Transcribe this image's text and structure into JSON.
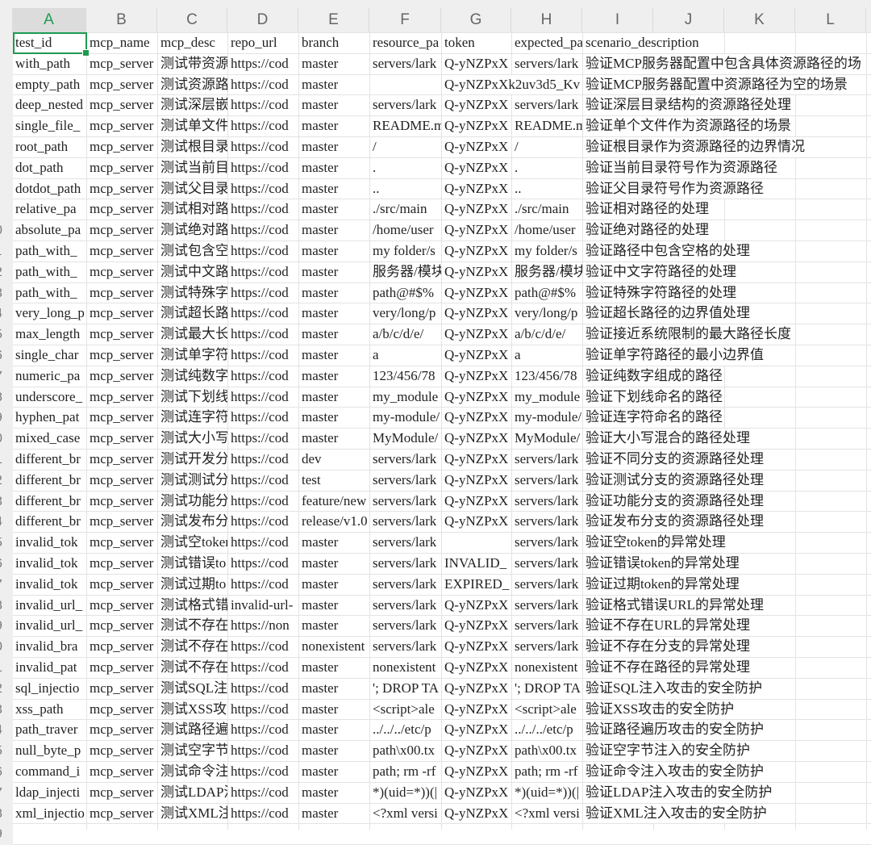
{
  "columns": [
    "A",
    "B",
    "C",
    "D",
    "E",
    "F",
    "G",
    "H",
    "I",
    "J",
    "K",
    "L"
  ],
  "selected_cell": "A1",
  "colors": {
    "accent": "#1f9a50",
    "grid": "#e3e3e3",
    "header_bg": "#efefef"
  },
  "rows": [
    [
      "test_id",
      "mcp_name",
      "mcp_desc",
      "repo_url",
      "branch",
      "resource_pa",
      "token",
      "expected_pa",
      "scenario_description"
    ],
    [
      "with_path",
      "mcp_server",
      "测试带资源",
      "https://cod",
      "master",
      "servers/lark",
      "Q-yNZPxX",
      "servers/lark",
      "验证MCP服务器配置中包含具体资源路径的场"
    ],
    [
      "empty_path",
      "mcp_server",
      "测试资源路",
      "https://cod",
      "master",
      "",
      "Q-yNZPxXk2uv3d5_Kv",
      "",
      "验证MCP服务器配置中资源路径为空的场景"
    ],
    [
      "deep_nested",
      "mcp_server",
      "测试深层嵌",
      "https://cod",
      "master",
      "servers/lark",
      "Q-yNZPxX",
      "servers/lark",
      "验证深层目录结构的资源路径处理"
    ],
    [
      "single_file_",
      "mcp_server",
      "测试单文件",
      "https://cod",
      "master",
      "README.md",
      "Q-yNZPxX",
      "README.md",
      "验证单个文件作为资源路径的场景"
    ],
    [
      "root_path",
      "mcp_server",
      "测试根目录",
      "https://cod",
      "master",
      "/",
      "Q-yNZPxX",
      "/",
      "验证根目录作为资源路径的边界情况"
    ],
    [
      "dot_path",
      "mcp_server",
      "测试当前目",
      "https://cod",
      "master",
      ".",
      "Q-yNZPxX",
      ".",
      "验证当前目录符号作为资源路径"
    ],
    [
      "dotdot_path",
      "mcp_server",
      "测试父目录",
      "https://cod",
      "master",
      "..",
      "Q-yNZPxX",
      "..",
      "验证父目录符号作为资源路径"
    ],
    [
      "relative_pa",
      "mcp_server",
      "测试相对路",
      "https://cod",
      "master",
      "./src/main",
      "Q-yNZPxX",
      "./src/main",
      "验证相对路径的处理"
    ],
    [
      "absolute_pa",
      "mcp_server",
      "测试绝对路",
      "https://cod",
      "master",
      "/home/user",
      "Q-yNZPxX",
      "/home/user",
      "验证绝对路径的处理"
    ],
    [
      "path_with_",
      "mcp_server",
      "测试包含空",
      "https://cod",
      "master",
      "my folder/s",
      "Q-yNZPxX",
      "my folder/s",
      "验证路径中包含空格的处理"
    ],
    [
      "path_with_",
      "mcp_server",
      "测试中文路",
      "https://cod",
      "master",
      "服务器/模块",
      "Q-yNZPxX",
      "服务器/模块",
      "验证中文字符路径的处理"
    ],
    [
      "path_with_",
      "mcp_server",
      "测试特殊字",
      "https://cod",
      "master",
      "path@#$%",
      "Q-yNZPxX",
      "path@#$%",
      "验证特殊字符路径的处理"
    ],
    [
      "very_long_p",
      "mcp_server",
      "测试超长路",
      "https://cod",
      "master",
      "very/long/p",
      "Q-yNZPxX",
      "very/long/p",
      "验证超长路径的边界值处理"
    ],
    [
      "max_length",
      "mcp_server",
      "测试最大长",
      "https://cod",
      "master",
      "a/b/c/d/e/",
      "Q-yNZPxX",
      "a/b/c/d/e/",
      "验证接近系统限制的最大路径长度"
    ],
    [
      "single_char",
      "mcp_server",
      "测试单字符",
      "https://cod",
      "master",
      "a",
      "Q-yNZPxX",
      "a",
      "验证单字符路径的最小边界值"
    ],
    [
      "numeric_pa",
      "mcp_server",
      "测试纯数字",
      "https://cod",
      "master",
      "123/456/78",
      "Q-yNZPxX",
      "123/456/78",
      "验证纯数字组成的路径"
    ],
    [
      "underscore_",
      "mcp_server",
      "测试下划线",
      "https://cod",
      "master",
      "my_module",
      "Q-yNZPxX",
      "my_module",
      "验证下划线命名的路径"
    ],
    [
      "hyphen_pat",
      "mcp_server",
      "测试连字符",
      "https://cod",
      "master",
      "my-module/",
      "Q-yNZPxX",
      "my-module/",
      "验证连字符命名的路径"
    ],
    [
      "mixed_case",
      "mcp_server",
      "测试大小写",
      "https://cod",
      "master",
      "MyModule/",
      "Q-yNZPxX",
      "MyModule/",
      "验证大小写混合的路径处理"
    ],
    [
      "different_br",
      "mcp_server",
      "测试开发分",
      "https://cod",
      "dev",
      "servers/lark",
      "Q-yNZPxX",
      "servers/lark",
      "验证不同分支的资源路径处理"
    ],
    [
      "different_br",
      "mcp_server",
      "测试测试分",
      "https://cod",
      "test",
      "servers/lark",
      "Q-yNZPxX",
      "servers/lark",
      "验证测试分支的资源路径处理"
    ],
    [
      "different_br",
      "mcp_server",
      "测试功能分",
      "https://cod",
      "feature/new",
      "servers/lark",
      "Q-yNZPxX",
      "servers/lark",
      "验证功能分支的资源路径处理"
    ],
    [
      "different_br",
      "mcp_server",
      "测试发布分",
      "https://cod",
      "release/v1.0",
      "servers/lark",
      "Q-yNZPxX",
      "servers/lark",
      "验证发布分支的资源路径处理"
    ],
    [
      "invalid_tok",
      "mcp_server",
      "测试空token",
      "https://cod",
      "master",
      "servers/lark",
      "",
      "servers/lark",
      "验证空token的异常处理"
    ],
    [
      "invalid_tok",
      "mcp_server",
      "测试错误to",
      "https://cod",
      "master",
      "servers/lark",
      "INVALID_",
      "servers/lark",
      "验证错误token的异常处理"
    ],
    [
      "invalid_tok",
      "mcp_server",
      "测试过期to",
      "https://cod",
      "master",
      "servers/lark",
      "EXPIRED_",
      "servers/lark",
      "验证过期token的异常处理"
    ],
    [
      "invalid_url_",
      "mcp_server",
      "测试格式错",
      "invalid-url-",
      "master",
      "servers/lark",
      "Q-yNZPxX",
      "servers/lark",
      "验证格式错误URL的异常处理"
    ],
    [
      "invalid_url_",
      "mcp_server",
      "测试不存在",
      "https://non",
      "master",
      "servers/lark",
      "Q-yNZPxX",
      "servers/lark",
      "验证不存在URL的异常处理"
    ],
    [
      "invalid_bra",
      "mcp_server",
      "测试不存在",
      "https://cod",
      "nonexistent",
      "servers/lark",
      "Q-yNZPxX",
      "servers/lark",
      "验证不存在分支的异常处理"
    ],
    [
      "invalid_pat",
      "mcp_server",
      "测试不存在",
      "https://cod",
      "master",
      "nonexistent",
      "Q-yNZPxX",
      "nonexistent",
      "验证不存在路径的异常处理"
    ],
    [
      "sql_injectio",
      "mcp_server",
      "测试SQL注",
      "https://cod",
      "master",
      "'; DROP TA",
      "Q-yNZPxX",
      "'; DROP TA",
      "验证SQL注入攻击的安全防护"
    ],
    [
      "xss_path",
      "mcp_server",
      "测试XSS攻",
      "https://cod",
      "master",
      "<script>ale",
      "Q-yNZPxX",
      "<script>ale",
      "验证XSS攻击的安全防护"
    ],
    [
      "path_traver",
      "mcp_server",
      "测试路径遍",
      "https://cod",
      "master",
      "../../../etc/p",
      "Q-yNZPxX",
      "../../../etc/p",
      "验证路径遍历攻击的安全防护"
    ],
    [
      "null_byte_p",
      "mcp_server",
      "测试空字节",
      "https://cod",
      "master",
      "path\\x00.tx",
      "Q-yNZPxX",
      "path\\x00.tx",
      "验证空字节注入的安全防护"
    ],
    [
      "command_i",
      "mcp_server",
      "测试命令注",
      "https://cod",
      "master",
      "path; rm -rf",
      "Q-yNZPxX",
      "path; rm -rf",
      "验证命令注入攻击的安全防护"
    ],
    [
      "ldap_injecti",
      "mcp_server",
      "测试LDAP注",
      "https://cod",
      "master",
      "*)(uid=*))(|",
      "Q-yNZPxX",
      "*)(uid=*))(|",
      "验证LDAP注入攻击的安全防护"
    ],
    [
      "xml_injectio",
      "mcp_server",
      "测试XML注",
      "https://cod",
      "master",
      "<?xml versi",
      "Q-yNZPxX",
      "<?xml versi",
      "验证XML注入攻击的安全防护"
    ]
  ]
}
